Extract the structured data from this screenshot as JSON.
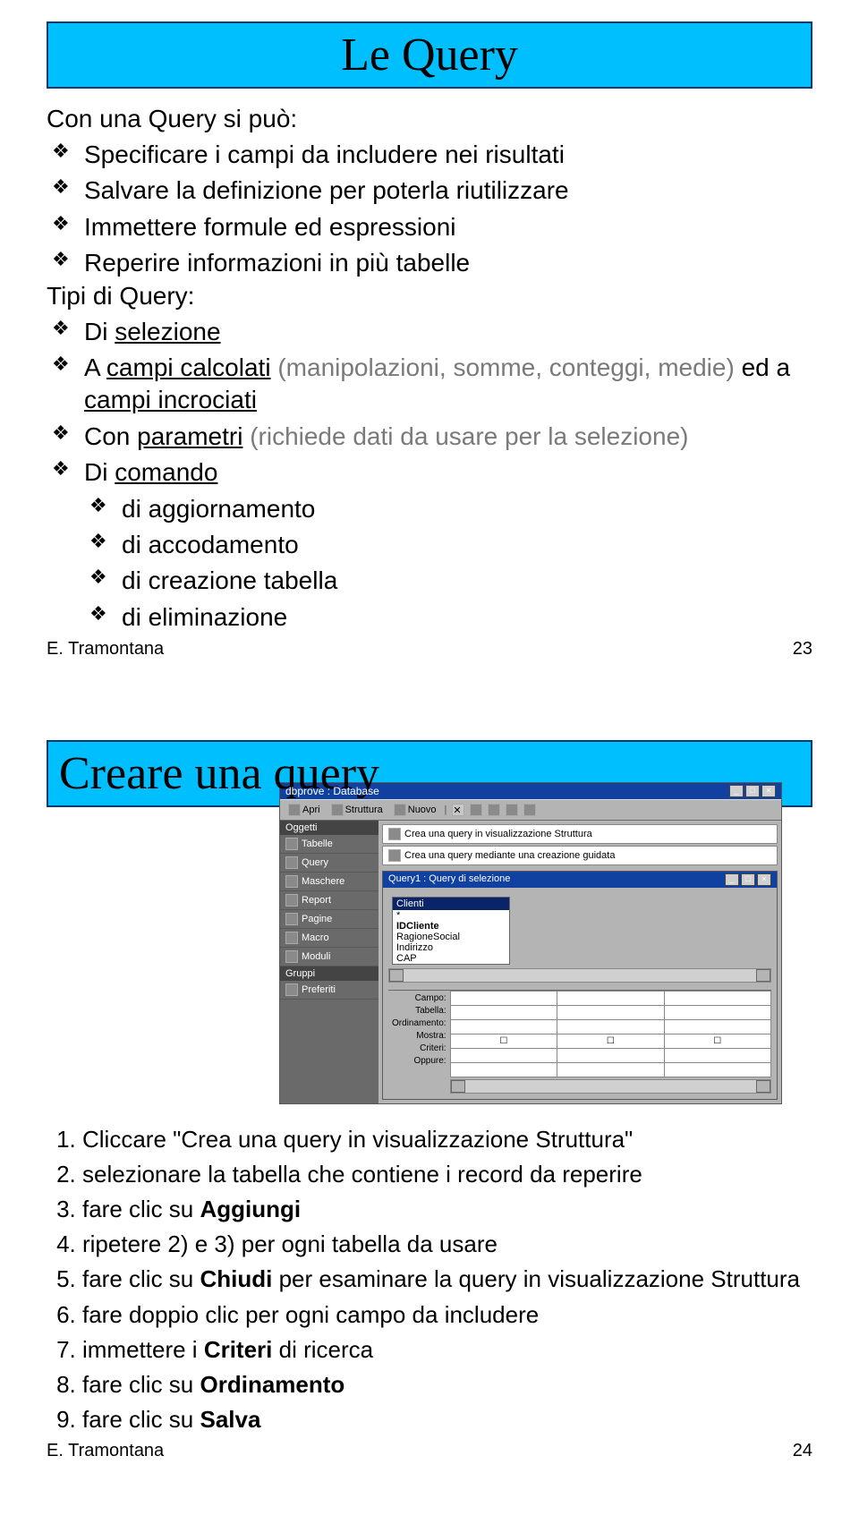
{
  "slide1": {
    "title": "Le Query",
    "intro1": "Con una Query si può:",
    "b1": "Specificare i campi da includere nei risultati",
    "b2": "Salvare la definizione per poterla riutilizzare",
    "b3": "Immettere formule ed espressioni",
    "b4": "Reperire informazioni in più tabelle",
    "intro2": "Tipi di Query:",
    "t1": "Di ",
    "t1u": "selezione",
    "t2": "A ",
    "t2u": "campi calcolati",
    "t2g": "  (manipolazioni, somme, conteggi, medie)",
    "t2b": "  ed a ",
    "t2u2": "campi incrociati",
    "t3": "Con ",
    "t3u": "parametri",
    "t3g": "  (richiede dati da usare per la selezione)",
    "t4": "Di ",
    "t4u": "comando",
    "s1": "di aggiornamento",
    "s2": "di accodamento",
    "s3": "di creazione tabella",
    "s4": "di eliminazione",
    "footer_author": "E. Tramontana",
    "footer_page": "23"
  },
  "slide2": {
    "title": "Creare una query",
    "app": {
      "title": "dbprove : Database",
      "tb_apri": "Apri",
      "tb_struttura": "Struttura",
      "tb_nuovo": "Nuovo",
      "side_header": "Oggetti",
      "side_items": [
        "Tabelle",
        "Query",
        "Maschere",
        "Report",
        "Pagine",
        "Macro",
        "Moduli"
      ],
      "side_group2": "Gruppi",
      "side_pref": "Preferiti",
      "opt1": "Crea una query in visualizzazione Struttura",
      "opt2": "Crea una query mediante una creazione guidata",
      "inner_title": "Query1 : Query di selezione",
      "fl_title": "Clienti",
      "fields": [
        "*",
        "IDCliente",
        "RagioneSocial",
        "Indirizzo",
        "CAP"
      ],
      "grid_labels": [
        "Campo:",
        "Tabella:",
        "Ordinamento:",
        "Mostra:",
        "Criteri:",
        "Oppure:"
      ]
    },
    "steps": [
      "Cliccare \"Crea una query in visualizzazione Struttura\"",
      "selezionare la tabella che contiene i record da reperire",
      "fare clic su Aggiungi",
      "ripetere 2) e 3) per ogni tabella da usare",
      "fare clic su Chiudi per esaminare la query in visualizzazione Struttura",
      "fare doppio clic per ogni campo da includere",
      "immettere i Criteri di ricerca",
      "fare clic su Ordinamento",
      "fare clic su Salva"
    ],
    "step3_bold": "Aggiungi",
    "step5_bold": "Chiudi",
    "step7_bold": "Criteri",
    "step8_bold": "Ordinamento",
    "step9_bold": "Salva",
    "footer_author": "E. Tramontana",
    "footer_page": "24"
  }
}
